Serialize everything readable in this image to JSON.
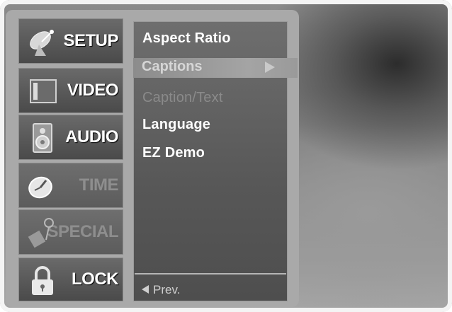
{
  "tabs": [
    {
      "label": "SETUP",
      "icon": "satellite-dish-icon",
      "active": true
    },
    {
      "label": "VIDEO",
      "icon": "screen-icon",
      "active": false
    },
    {
      "label": "AUDIO",
      "icon": "speaker-icon",
      "active": false
    },
    {
      "label": "TIME",
      "icon": "clock-icon",
      "active": false
    },
    {
      "label": "SPECIAL",
      "icon": "special-icon",
      "active": false
    },
    {
      "label": "LOCK",
      "icon": "padlock-icon",
      "active": false
    }
  ],
  "submenu": {
    "items": [
      {
        "label": "Aspect Ratio",
        "state": "normal"
      },
      {
        "label": "Captions",
        "state": "highlighted"
      },
      {
        "label": "Caption/Text",
        "state": "disabled"
      },
      {
        "label": "Language",
        "state": "normal"
      },
      {
        "label": "EZ Demo",
        "state": "normal"
      }
    ],
    "prev_label": "Prev."
  }
}
